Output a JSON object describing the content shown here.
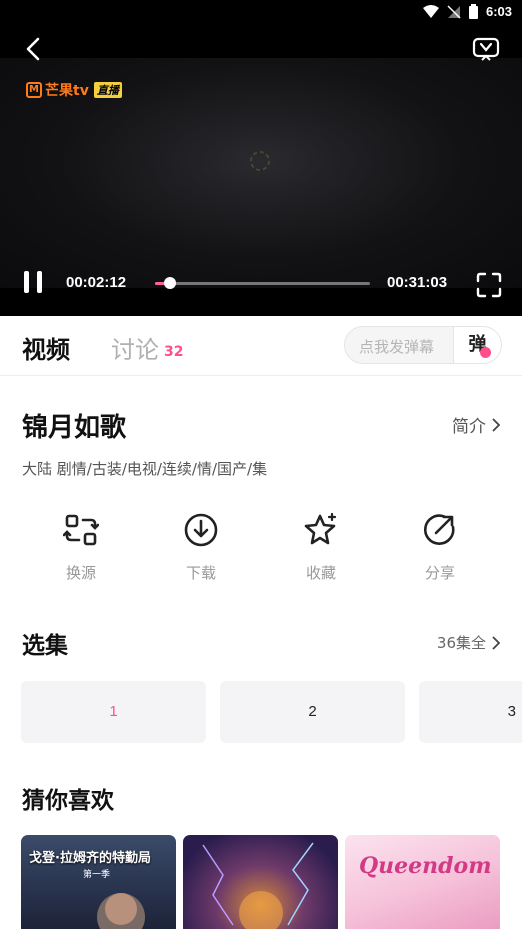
{
  "status_bar": {
    "time": "6:03"
  },
  "player": {
    "brand": "芒果tv",
    "live_badge": "直播",
    "current_time": "00:02:12",
    "total_time": "00:31:03",
    "progress": 0.07
  },
  "tabs": {
    "video_label": "视频",
    "discuss_label": "讨论",
    "discuss_count": "32"
  },
  "danmaku": {
    "placeholder": "点我发弹幕",
    "button_label": "弹"
  },
  "show": {
    "title": "锦月如歌",
    "intro_label": "简介",
    "tags": "大陆 剧情/古装/电视/连续/情/国产/集"
  },
  "actions": [
    {
      "label": "换源",
      "icon": "switch-source-icon"
    },
    {
      "label": "下载",
      "icon": "download-icon"
    },
    {
      "label": "收藏",
      "icon": "star-icon"
    },
    {
      "label": "分享",
      "icon": "share-icon"
    }
  ],
  "episodes": {
    "section_title": "选集",
    "all_label": "36集全",
    "items": [
      "1",
      "2",
      "3"
    ],
    "selected": "1"
  },
  "recommend": {
    "section_title": "猜你喜欢",
    "posters": [
      {
        "title": "戈登·拉姆齐的特勤局",
        "subtitle": "第一季"
      },
      {
        "title": ""
      },
      {
        "title": "Queendom"
      }
    ]
  },
  "colors": {
    "accent": "#ff4f8b",
    "player_bg": "#000000"
  }
}
